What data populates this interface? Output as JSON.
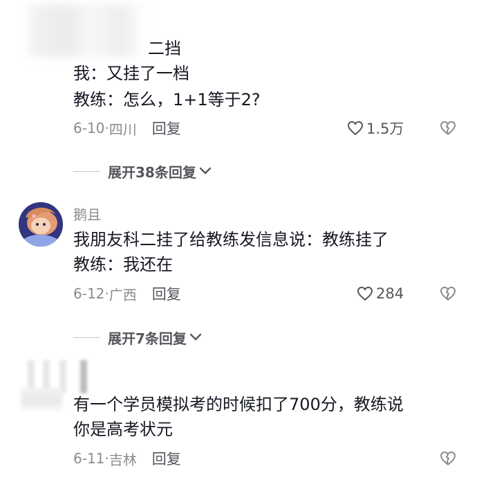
{
  "comments": [
    {
      "lines": [
        "二挡",
        "我：又挂了一档",
        "教练：怎么，1+1等于2?"
      ],
      "date": "6-10",
      "location": "四川",
      "reply_label": "回复",
      "likes": "1.5万",
      "expand_label": "展开38条回复"
    },
    {
      "username": "鹅且",
      "lines": [
        "我朋友科二挂了给教练发信息说：教练挂了",
        "教练：我还在"
      ],
      "date": "6-12",
      "location": "广西",
      "reply_label": "回复",
      "likes": "284",
      "expand_label": "展开7条回复"
    },
    {
      "lines": [
        "有一个学员模拟考的时候扣了700分，教练说",
        "你是高考状元"
      ],
      "date": "6-11",
      "location": "吉林",
      "reply_label": "回复"
    }
  ],
  "icons": {
    "like": "heart-outline-icon",
    "dislike": "broken-heart-icon",
    "expand": "chevron-down-icon"
  },
  "colors": {
    "text": "#161823",
    "meta": "#8a8b91",
    "secondary": "#55565c"
  }
}
